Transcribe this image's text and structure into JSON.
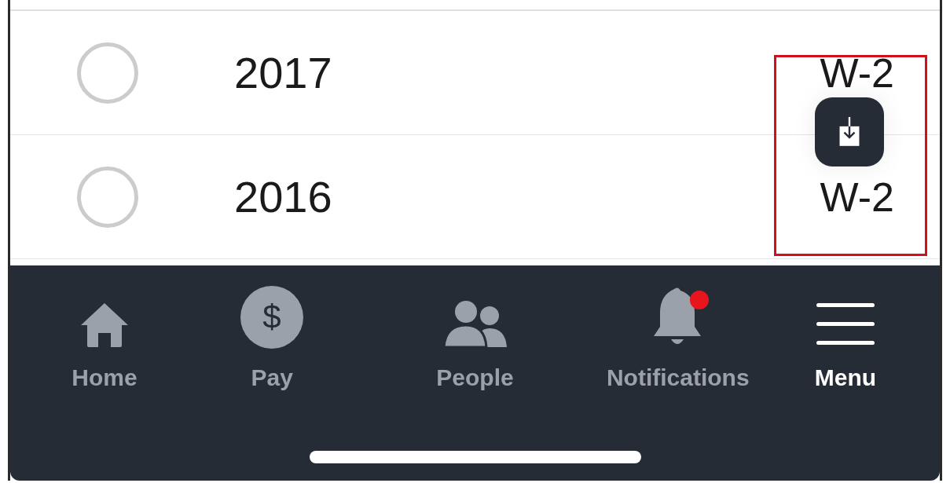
{
  "documents": [
    {
      "year": "2017",
      "form": "W-2",
      "selected": false
    },
    {
      "year": "2016",
      "form": "W-2",
      "selected": false
    }
  ],
  "download_button": {
    "highlighted": true
  },
  "tab_bar": [
    {
      "kind": "home",
      "label": "Home",
      "selected": false,
      "badge": false
    },
    {
      "kind": "pay",
      "label": "Pay",
      "symbol": "$",
      "selected": false,
      "badge": false
    },
    {
      "kind": "people",
      "label": "People",
      "selected": false,
      "badge": false
    },
    {
      "kind": "bell",
      "label": "Notifications",
      "selected": false,
      "badge": true
    },
    {
      "kind": "menu",
      "label": "Menu",
      "selected": true,
      "badge": false
    }
  ]
}
